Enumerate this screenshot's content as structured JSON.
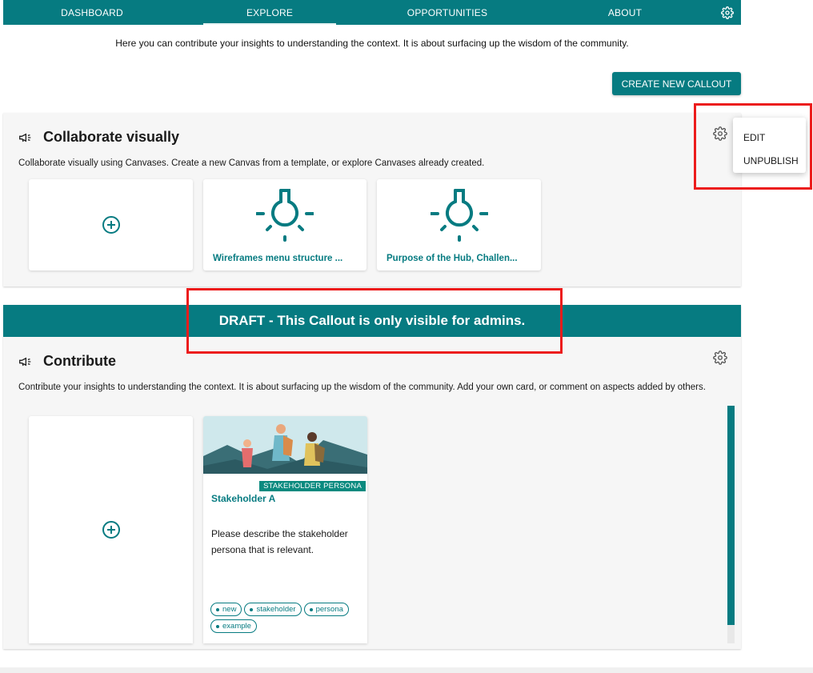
{
  "nav": {
    "tabs": [
      {
        "label": "DASHBOARD"
      },
      {
        "label": "EXPLORE"
      },
      {
        "label": "OPPORTUNITIES"
      },
      {
        "label": "ABOUT"
      }
    ],
    "active_tab": "EXPLORE",
    "settings_icon": "gear-icon"
  },
  "intro_text": "Here you can contribute your insights to understanding the context. It is about surfacing up the wisdom of the community.",
  "create_button_label": "CREATE NEW CALLOUT",
  "callouts": [
    {
      "title": "Collaborate visually",
      "description": "Collaborate visually using Canvases. Create a new Canvas from a template, or explore Canvases already created.",
      "icon": "megaphone-icon",
      "cards": [
        {
          "type": "add",
          "icon": "plus-circle-icon"
        },
        {
          "type": "canvas",
          "title": "Wireframes menu structure ...",
          "icon": "lightbulb-icon"
        },
        {
          "type": "canvas",
          "title": "Purpose of the Hub, Challen...",
          "icon": "lightbulb-icon"
        }
      ]
    },
    {
      "draft_banner": "DRAFT - This Callout is only visible for admins.",
      "title": "Contribute",
      "description": "Contribute your insights to understanding the context. It is about surfacing up the wisdom of the community. Add your own card, or comment on aspects added by others.",
      "icon": "megaphone-icon",
      "cards": [
        {
          "type": "add",
          "icon": "plus-circle-icon"
        },
        {
          "type": "persona",
          "badge": "STAKEHOLDER PERSONA",
          "title": "Stakeholder A",
          "description": "Please describe the stakeholder persona that is relevant.",
          "tags": [
            "new",
            "stakeholder",
            "persona",
            "example"
          ]
        }
      ]
    }
  ],
  "context_menu": {
    "items": [
      {
        "label": "EDIT"
      },
      {
        "label": "UNPUBLISH"
      }
    ]
  },
  "colors": {
    "primary": "#067b81",
    "highlight": "#ec1c1c",
    "badge": "#0a8a7f"
  }
}
